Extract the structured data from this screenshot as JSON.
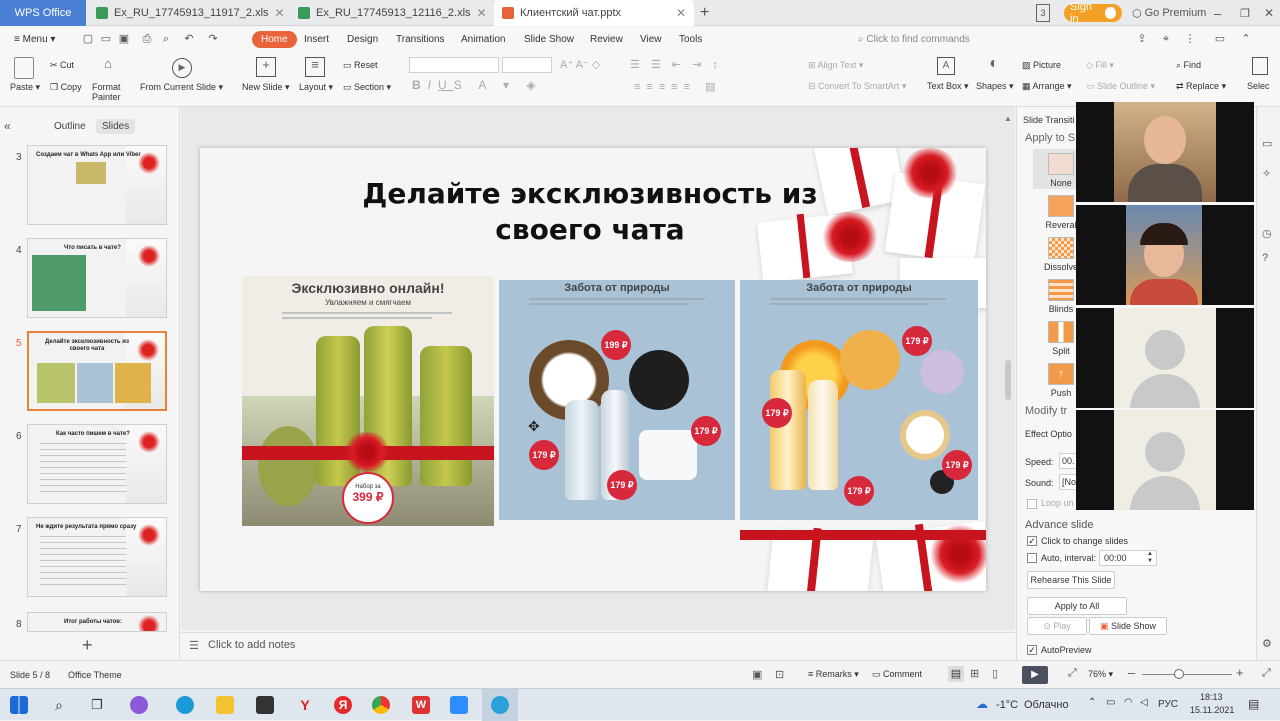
{
  "titlebar": {
    "wps_tab": "WPS Office",
    "tabs": [
      {
        "label": "Ex_RU_17745913_11917_2.xls"
      },
      {
        "label": "Ex_RU_17745913_12116_2.xls"
      },
      {
        "label": "Клиентский чат.pptx"
      }
    ],
    "sign_in": "Sign in",
    "go_premium": "Go Premium"
  },
  "menubar": {
    "menu": "Menu",
    "items": [
      "Home",
      "Insert",
      "Design",
      "Transitions",
      "Animation",
      "Slide Show",
      "Review",
      "View",
      "Tools"
    ],
    "search_placeholder": "Click to find commands"
  },
  "ribbon": {
    "paste": "Paste",
    "cut": "Cut",
    "copy": "Copy",
    "format_painter_1": "Format",
    "format_painter_2": "Painter",
    "from_current_slide": "From Current Slide",
    "new_slide": "New Slide",
    "layout": "Layout",
    "reset": "Reset",
    "section": "Section",
    "align_text": "Align Text",
    "convert_smartart": "Convert To SmartArt",
    "text_box": "Text Box",
    "shapes": "Shapes",
    "picture": "Picture",
    "arrange": "Arrange",
    "fill": "Fill",
    "slide_outline": "Slide Outline",
    "find": "Find",
    "replace": "Replace",
    "select": "Selec"
  },
  "leftpane": {
    "tab_outline": "Outline",
    "tab_slides": "Slides",
    "thumbs": [
      {
        "num": "3",
        "title": "Создаем чат в Whats App или Viber"
      },
      {
        "num": "4",
        "title": "Что писать в чате?"
      },
      {
        "num": "5",
        "title": "Делайте эксклюзивность из своего чата"
      },
      {
        "num": "6",
        "title": "Как часто пишем в чате?"
      },
      {
        "num": "7",
        "title": "Не ждите результата прямо сразу"
      },
      {
        "num": "8",
        "title": "Итог работы чатов:"
      }
    ]
  },
  "slide": {
    "title_line1": "Делайте эксклюзивность из",
    "title_line2": "своего чата",
    "panel1_heading": "Эксклюзивно онлайн!",
    "panel1_sub": "Увлажняем и смягчаем",
    "panel1_price_label": "Набор за",
    "panel1_price": "399 ₽",
    "panel2_heading": "Забота от природы",
    "panel3_heading": "Забота от природы",
    "prices": [
      "199 ₽",
      "179 ₽",
      "179 ₽",
      "179 ₽",
      "179 ₽",
      "179 ₽",
      "179 ₽",
      "179 ₽"
    ]
  },
  "notes": {
    "placeholder": "Click to add notes"
  },
  "rightpane": {
    "title": "Slide Transiti",
    "apply_to": "Apply to S",
    "transitions": [
      "None",
      "Reveral",
      "Dissolve",
      "Blinds",
      "Split",
      "Push"
    ],
    "modify": "Modify tr",
    "effect_options": "Effect Optio",
    "speed_label": "Speed:",
    "speed_value": "00.",
    "sound_label": "Sound:",
    "sound_value": "[No",
    "loop": "Loop un",
    "advance": "Advance slide",
    "click_to_change": "Click to change slides",
    "auto_interval": "Auto, interval:",
    "interval_value": "00:00",
    "rehearse": "Rehearse This Slide",
    "apply_all": "Apply to All",
    "play": "Play",
    "slide_show": "Slide Show",
    "autopreview": "AutoPreview"
  },
  "status": {
    "slide_count": "Slide 5 / 8",
    "theme": "Office Theme",
    "remarks": "Remarks",
    "comment": "Comment",
    "zoom": "76%"
  },
  "taskbar": {
    "weather_temp": "-1°C",
    "weather_text": "Облачно",
    "lang": "РУС",
    "time": "18:13",
    "date": "15.11.2021"
  },
  "colors": {
    "accent": "#e8623a",
    "wps_blue": "#4a7fd6",
    "price_red": "#d8283c",
    "ribbon_red": "#c8141e"
  }
}
